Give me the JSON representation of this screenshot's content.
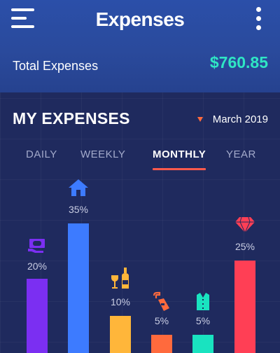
{
  "header": {
    "title": "Expenses",
    "total_label": "Total Expenses",
    "total_amount": "$760.85",
    "menu_icon": "hamburger-menu-icon",
    "more_icon": "vertical-dots-icon"
  },
  "section": {
    "title": "MY EXPENSES",
    "selected_month": "March 2019",
    "dropdown_icon": "triangle-down-icon"
  },
  "tabs": [
    {
      "label": "DAILY",
      "active": false
    },
    {
      "label": "WEEKLY",
      "active": false
    },
    {
      "label": "MONTHLY",
      "active": true
    },
    {
      "label": "YEAR",
      "active": false
    }
  ],
  "colors": {
    "accent": "#2fe6c4",
    "tab_underline": "#ff5a4c",
    "bills": "#7b2ff2",
    "home": "#3d7bff",
    "drinks": "#ffb63a",
    "fuel": "#ff6a3d",
    "clothing": "#19e3c0",
    "jewelry": "#ff3f55"
  },
  "chart_data": {
    "type": "bar",
    "categories": [
      "bills",
      "home",
      "drinks",
      "fuel",
      "clothing",
      "jewelry"
    ],
    "values": [
      20,
      35,
      10,
      5,
      5,
      25
    ],
    "labels": [
      "20%",
      "35%",
      "10%",
      "5%",
      "5%",
      "25%"
    ],
    "icons": [
      "money-icon",
      "house-icon",
      "wine-icon",
      "fuel-pump-icon",
      "shirt-icon",
      "diamond-icon"
    ],
    "colors": [
      "#7b2ff2",
      "#3d7bff",
      "#ffb63a",
      "#ff6a3d",
      "#19e3c0",
      "#ff3f55"
    ],
    "ylim": [
      0,
      35
    ]
  }
}
